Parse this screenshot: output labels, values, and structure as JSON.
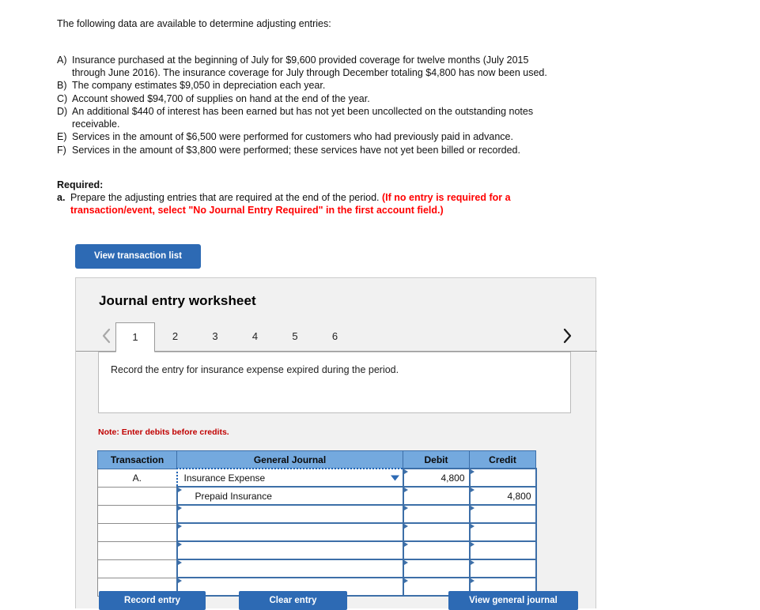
{
  "problem": {
    "intro": "The following data are available to determine adjusting entries:",
    "items": [
      {
        "label": "A)",
        "text": "Insurance purchased at the beginning of July for $9,600 provided coverage for twelve months (July 2015 through June 2016). The insurance coverage for July through December totaling $4,800 has now been used."
      },
      {
        "label": "B)",
        "text": "The company estimates $9,050 in depreciation each year."
      },
      {
        "label": "C)",
        "text": "Account showed $94,700 of supplies on hand at the end of the year."
      },
      {
        "label": "D)",
        "text": "An additional $440 of interest has been earned but has not yet been uncollected on the outstanding notes receivable."
      },
      {
        "label": "E)",
        "text": "Services in the amount of $6,500 were performed for customers who had previously paid in advance."
      },
      {
        "label": "F)",
        "text": "Services in the amount of $3,800 were performed; these services have not yet been billed or recorded."
      }
    ]
  },
  "required": {
    "heading": "Required:",
    "item_label": "a.",
    "item_text": "Prepare the adjusting entries that are required at the end of the period. ",
    "item_emphasis": "(If no entry is required for a transaction/event, select \"No Journal Entry Required\" in the first account field.)"
  },
  "buttons": {
    "view_transaction_list": "View transaction list",
    "record_entry": "Record entry",
    "clear_entry": "Clear entry",
    "view_general_journal": "View general journal"
  },
  "worksheet": {
    "title": "Journal entry worksheet",
    "prev_icon": "chevron-left-icon",
    "next_icon": "chevron-right-icon",
    "tabs": [
      {
        "label": "1",
        "active": true
      },
      {
        "label": "2",
        "active": false
      },
      {
        "label": "3",
        "active": false
      },
      {
        "label": "4",
        "active": false
      },
      {
        "label": "5",
        "active": false
      },
      {
        "label": "6",
        "active": false
      }
    ],
    "instruction": "Record the entry for insurance expense expired during the period.",
    "note": "Note: Enter debits before credits."
  },
  "journal": {
    "headers": {
      "transaction": "Transaction",
      "general_journal": "General Journal",
      "debit": "Debit",
      "credit": "Credit"
    },
    "rows": [
      {
        "transaction": "A.",
        "account": "Insurance Expense",
        "debit": "4,800",
        "credit": "",
        "indent": false,
        "selected": true,
        "dropdown": true
      },
      {
        "transaction": "",
        "account": "Prepaid Insurance",
        "debit": "",
        "credit": "4,800",
        "indent": true,
        "selected": false,
        "dropdown": false
      },
      {
        "transaction": "",
        "account": "",
        "debit": "",
        "credit": "",
        "indent": false,
        "selected": false,
        "dropdown": false
      },
      {
        "transaction": "",
        "account": "",
        "debit": "",
        "credit": "",
        "indent": false,
        "selected": false,
        "dropdown": false
      },
      {
        "transaction": "",
        "account": "",
        "debit": "",
        "credit": "",
        "indent": false,
        "selected": false,
        "dropdown": false
      },
      {
        "transaction": "",
        "account": "",
        "debit": "",
        "credit": "",
        "indent": false,
        "selected": false,
        "dropdown": false
      },
      {
        "transaction": "",
        "account": "",
        "debit": "",
        "credit": "",
        "indent": false,
        "selected": false,
        "dropdown": false
      }
    ]
  },
  "colors": {
    "button_blue": "#2d6ab4",
    "table_header_blue": "#74a9de",
    "cell_border_blue": "#3d6fa8",
    "alert_red": "#ff0000",
    "note_red": "#c00000",
    "panel_bg": "#f1f1f1"
  }
}
